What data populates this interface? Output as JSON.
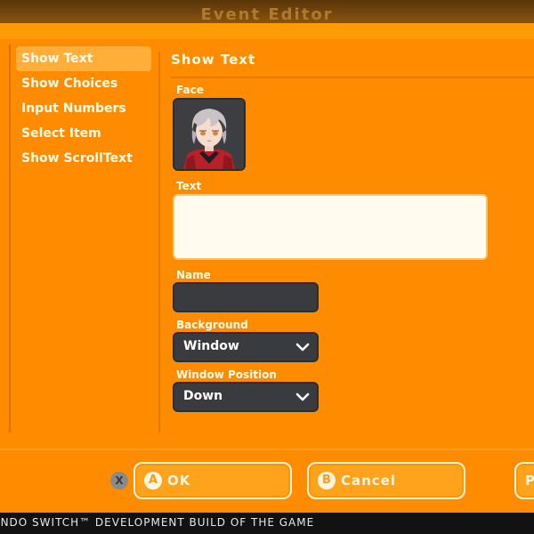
{
  "window": {
    "title": "Event Editor"
  },
  "commands": [
    {
      "label": "Show Text",
      "active": true
    },
    {
      "label": "Show Choices",
      "active": false
    },
    {
      "label": "Input Numbers",
      "active": false
    },
    {
      "label": "Select Item",
      "active": false
    },
    {
      "label": "Show ScrollText",
      "active": false
    }
  ],
  "panel": {
    "title": "Show Text",
    "face_label": "Face",
    "text_label": "Text",
    "text_value": "",
    "name_label": "Name",
    "name_value": "",
    "background_label": "Background",
    "background_value": "Window",
    "position_label": "Window Position",
    "position_value": "Down"
  },
  "buttons": {
    "x_badge": "X",
    "ok_badge": "A",
    "ok_label": "OK",
    "cancel_badge": "B",
    "cancel_label": "Cancel",
    "partial_label": "P"
  },
  "footer": {
    "text": "ENDO SWITCH™ DEVELOPMENT BUILD OF THE GAME"
  },
  "colors": {
    "accent": "#ff8c00",
    "highlight": "#ffae3a",
    "dark_field": "#3a3b3e",
    "text_light": "#fffbe9"
  },
  "icons": {
    "face_portrait": "character-portrait",
    "dropdown": "chevron-down-icon"
  }
}
